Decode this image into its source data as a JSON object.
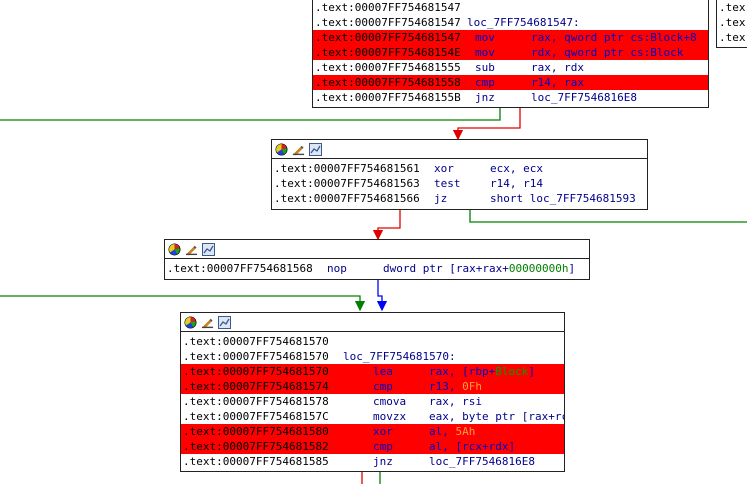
{
  "colors": {
    "highlight": "#ff0000",
    "edge_true": "#008000",
    "edge_false": "#e00000",
    "edge_uncond": "#0000ff"
  },
  "icons": [
    "color-wheel-icon",
    "edit-pencil-icon",
    "graph-mode-icon"
  ],
  "block_top": {
    "rows": [
      {
        "addr": ".text:00007FF754681547",
        "label": "",
        "mn": "",
        "op": "",
        "hl": false
      },
      {
        "addr": ".text:00007FF754681547",
        "label": "loc_7FF754681547:",
        "mn": "",
        "op": "",
        "hl": false
      },
      {
        "addr": ".text:00007FF754681547",
        "mn": "mov",
        "op": "rax, qword ptr cs:Block+8",
        "hl": true
      },
      {
        "addr": ".text:00007FF75468154E",
        "mn": "mov",
        "op": "rdx, qword ptr cs:Block",
        "hl": true
      },
      {
        "addr": ".text:00007FF754681555",
        "mn": "sub",
        "op": "rax, rdx",
        "hl": false
      },
      {
        "addr": ".text:00007FF754681558",
        "mn": "cmp",
        "op": "r14, rax",
        "hl": true
      },
      {
        "addr": ".text:00007FF75468155B",
        "mn": "jnz",
        "op": "loc_7FF7546816E8",
        "hl": false
      }
    ]
  },
  "block_right": {
    "rows": [
      ".tex",
      ".tex",
      ".tex"
    ]
  },
  "block_b2": {
    "rows": [
      {
        "addr": ".text:00007FF754681561",
        "mn": "xor",
        "op": "ecx, ecx",
        "hl": false
      },
      {
        "addr": ".text:00007FF754681563",
        "mn": "test",
        "op": "r14, r14",
        "hl": false
      },
      {
        "addr": ".text:00007FF754681566",
        "mn": "jz",
        "op": "short loc_7FF754681593",
        "hl": false
      }
    ]
  },
  "block_b3": {
    "rows": [
      {
        "addr": ".text:00007FF754681568",
        "mn": "nop",
        "op_a": "dword ptr [rax+rax+",
        "op_b": "00000000h",
        "op_c": "]",
        "hl": false
      }
    ]
  },
  "block_b4": {
    "rows": [
      {
        "addr": ".text:00007FF754681570",
        "label": "",
        "mn": "",
        "op": "",
        "hl": false
      },
      {
        "addr": ".text:00007FF754681570",
        "label": "loc_7FF754681570:",
        "mn": "",
        "op": "",
        "hl": false
      },
      {
        "addr": ".text:00007FF754681570",
        "mn": "lea",
        "op_a": "rax, [rbp+",
        "op_b": "Block",
        "op_c": "]",
        "hl": true
      },
      {
        "addr": ".text:00007FF754681574",
        "mn": "cmp",
        "op_a": "r13, ",
        "op_b": "0Fh",
        "op_c": "",
        "hl": true
      },
      {
        "addr": ".text:00007FF754681578",
        "mn": "cmova",
        "op": "rax, rsi",
        "hl": false
      },
      {
        "addr": ".text:00007FF75468157C",
        "mn": "movzx",
        "op": "eax, byte ptr [rax+rcx]",
        "hl": false
      },
      {
        "addr": ".text:00007FF754681580",
        "mn": "xor",
        "op_a": "al, ",
        "op_b": "5Ah",
        "op_c": "",
        "hl": true
      },
      {
        "addr": ".text:00007FF754681582",
        "mn": "cmp",
        "op": "al, [rcx+rdx]",
        "hl": true
      },
      {
        "addr": ".text:00007FF754681585",
        "mn": "jnz",
        "op": "loc_7FF7546816E8",
        "hl": false
      }
    ]
  }
}
